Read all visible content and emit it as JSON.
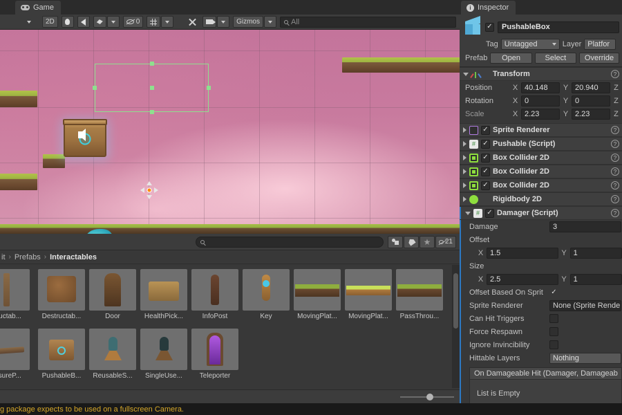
{
  "game_view": {
    "tab_label": "Game",
    "tab_icon": "game-controller-icon",
    "toolbar": {
      "display_dropdown_icon": "chevron-down-icon",
      "aspect_label": "2D",
      "lighting_icon": "lightbulb-icon",
      "audio_icon": "speaker-icon",
      "fx_icon": "effects-icon",
      "fx_caret_icon": "chevron-down-icon",
      "stats_icon": "eye-off-icon",
      "stats_value": "0",
      "gizmos_grid_icon": "gizmos-grid-icon",
      "gizmos_grid_caret_icon": "chevron-down-icon",
      "tools_icon": "tools-icon",
      "camera_icon": "camera-icon",
      "camera_caret_icon": "chevron-down-icon",
      "gizmos_label": "Gizmos",
      "gizmos_caret_icon": "chevron-down-icon",
      "search_icon": "search-icon",
      "search_placeholder": "All",
      "search_value": ""
    },
    "scene": {
      "background_top_color": "#c4749b",
      "background_bottom_color": "#d695b0",
      "selection_color": "#8ee08e",
      "gizmo_center_color": "#ff8a00",
      "platform_grass_color": "#a8bd49",
      "platform_dirt_color": "#6b4a30",
      "crate_color": "#a87d48",
      "creature_color": "#2fa9bd"
    }
  },
  "project_view": {
    "toolbar": {
      "search_icon": "search-icon",
      "search_placeholder": "",
      "search_value": "",
      "lock_icon": "lock-icon",
      "menu_icon": "kebab-menu-icon",
      "filter_type_icon": "filter-type-icon",
      "filter_label_icon": "label-tag-icon",
      "filter_favorite_icon": "star-icon",
      "hidden_icon": "eye-off-icon",
      "hidden_count": "21"
    },
    "breadcrumb": {
      "items": [
        "it",
        "Prefabs",
        "Interactables"
      ],
      "separator": "›"
    },
    "assets": [
      {
        "name": "structab...",
        "kind": "pillar"
      },
      {
        "name": "Destructab...",
        "kind": "rock"
      },
      {
        "name": "Door",
        "kind": "door"
      },
      {
        "name": "HealthPick...",
        "kind": "chest"
      },
      {
        "name": "InfoPost",
        "kind": "post"
      },
      {
        "name": "Key",
        "kind": "key"
      },
      {
        "name": "MovingPlat...",
        "kind": "platform-dark"
      },
      {
        "name": "MovingPlat...",
        "kind": "platform-light"
      },
      {
        "name": "PassThrou...",
        "kind": "platform-dark"
      },
      {
        "name": "essureP...",
        "kind": "plate"
      },
      {
        "name": "PushableB...",
        "kind": "crate"
      },
      {
        "name": "ReusableS...",
        "kind": "switch-teal"
      },
      {
        "name": "SingleUse...",
        "kind": "switch-dark"
      },
      {
        "name": "Teleporter",
        "kind": "teleporter"
      }
    ],
    "zoom_slider_value": 50
  },
  "inspector": {
    "tab_label": "Inspector",
    "tab_icon": "info-icon",
    "object": {
      "icon": "prefab-cube-icon",
      "enabled": true,
      "name": "PushableBox",
      "tag_label": "Tag",
      "tag_value": "Untagged",
      "layer_label": "Layer",
      "layer_value": "Platfor",
      "prefab_label": "Prefab",
      "open_button": "Open",
      "select_button": "Select",
      "overrides_button": "Override"
    },
    "transform": {
      "title": "Transform",
      "icon": "transform-axis-icon",
      "expanded": true,
      "rows": [
        {
          "label": "Position",
          "x": "40.148",
          "y": "20.940",
          "z_label": "Z",
          "dim": false
        },
        {
          "label": "Rotation",
          "x": "0",
          "y": "0",
          "z_label": "Z",
          "dim": false
        },
        {
          "label": "Scale",
          "x": "2.23",
          "y": "2.23",
          "z_label": "Z",
          "dim": true
        }
      ]
    },
    "components": [
      {
        "title": "Sprite Renderer",
        "icon": "sprite-renderer-icon",
        "has_checkbox": true,
        "checked": true
      },
      {
        "title": "Pushable (Script)",
        "icon": "script-icon",
        "has_checkbox": true,
        "checked": true
      },
      {
        "title": "Box Collider 2D",
        "icon": "box-collider-2d-icon",
        "has_checkbox": true,
        "checked": true
      },
      {
        "title": "Box Collider 2D",
        "icon": "box-collider-2d-icon",
        "has_checkbox": true,
        "checked": true
      },
      {
        "title": "Box Collider 2D",
        "icon": "box-collider-2d-icon",
        "has_checkbox": true,
        "checked": true
      },
      {
        "title": "Rigidbody 2D",
        "icon": "rigidbody-2d-icon",
        "has_checkbox": false,
        "checked": false
      }
    ],
    "damager": {
      "title": "Damager (Script)",
      "icon": "script-icon",
      "checked": true,
      "expanded": true,
      "damage_label": "Damage",
      "damage_value": "3",
      "offset_label": "Offset",
      "offset_x": "1.5",
      "offset_y": "1",
      "size_label": "Size",
      "size_x": "2.5",
      "size_y": "1",
      "offset_based_label": "Offset Based On Sprit",
      "offset_based_checked": true,
      "sprite_renderer_label": "Sprite Renderer",
      "sprite_renderer_value": "None (Sprite Render",
      "can_hit_triggers_label": "Can Hit Triggers",
      "can_hit_triggers_checked": false,
      "force_respawn_label": "Force Respawn",
      "force_respawn_checked": false,
      "ignore_invincibility_label": "Ignore Invincibility",
      "ignore_invincibility_checked": false,
      "hittable_layers_label": "Hittable Layers",
      "hittable_layers_value": "Nothing",
      "event_header": "On Damageable Hit (Damager, Damageab",
      "event_empty": "List is Empty"
    },
    "axis_x": "X",
    "axis_y": "Y",
    "help_icon": "help-icon"
  },
  "statusbar": {
    "message": "g package expects to be used on a fullscreen Camera.",
    "message_color": "#d6a829"
  }
}
